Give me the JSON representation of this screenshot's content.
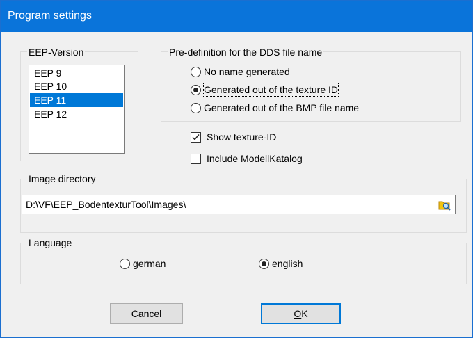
{
  "window": {
    "title": "Program settings"
  },
  "eep_version": {
    "label": "EEP-Version",
    "items": [
      "EEP 9",
      "EEP 10",
      "EEP 11",
      "EEP 12"
    ],
    "selected": "EEP 11"
  },
  "dds_name": {
    "label": "Pre-definition for the DDS file name",
    "options": [
      {
        "label": "No name generated",
        "checked": false
      },
      {
        "label": "Generated out of the texture ID",
        "checked": true
      },
      {
        "label": "Generated out of the BMP file name",
        "checked": false
      }
    ]
  },
  "checkboxes": {
    "show_texture_id": {
      "label": "Show texture-ID",
      "checked": true
    },
    "include_modellkatalog": {
      "label": "Include ModellKatalog",
      "checked": false
    }
  },
  "image_directory": {
    "label": "Image directory",
    "value": "D:\\VF\\EEP_BodentexturTool\\Images\\"
  },
  "language": {
    "label": "Language",
    "options": [
      {
        "label": "german",
        "checked": false
      },
      {
        "label": "english",
        "checked": true
      }
    ]
  },
  "buttons": {
    "cancel": "Cancel",
    "ok_mnemonic": "O",
    "ok_rest": "K"
  },
  "colors": {
    "titlebar": "#0a74da",
    "selection": "#0078d7",
    "dialog_bg": "#f0f0f0"
  }
}
